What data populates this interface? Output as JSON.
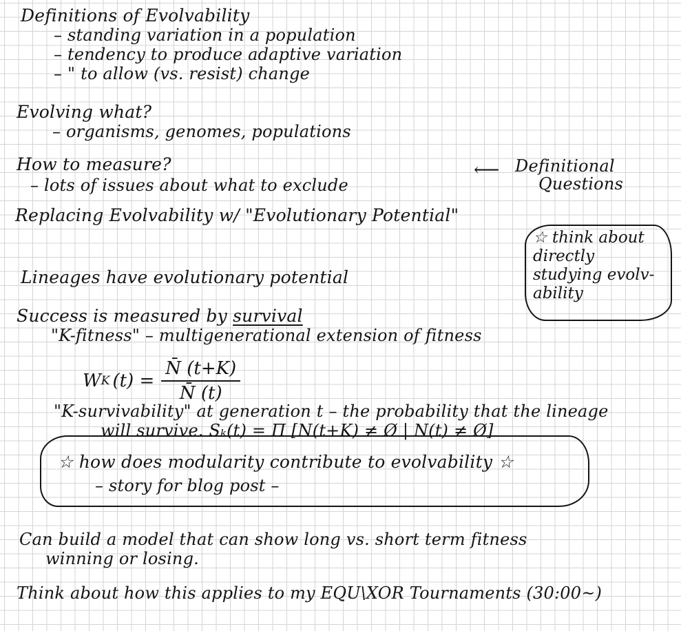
{
  "notes": {
    "l01": "Definitions of Evolvability",
    "l02": "– standing variation in a population",
    "l03": "– tendency to produce adaptive variation",
    "l04": "–     \"     to allow (vs. resist) change",
    "l05": "Evolving what?",
    "l06": "– organisms, genomes, populations",
    "l07": "How to measure?",
    "l08": "– lots of issues about what to exclude",
    "l09": "Definitional",
    "l10": "Questions",
    "l11": "Replacing Evolvability w/ \"Evolutionary Potential\"",
    "l12": "Lineages have evolutionary potential",
    "l13a": "Success is measured by ",
    "l13b": "survival",
    "l14": "\"K-fitness\" – multigenerational extension of fitness",
    "f_lhs": "W",
    "f_sub": "K",
    "f_arg": "(t) =",
    "f_num": "N̄ (t+K)",
    "f_den": "N̄ (t)",
    "l15": "\"K-survivability\" at generation t – the probability that the lineage",
    "l16": "will survive.  Sₖ(t) = Π [N(t+K) ≠ Ø | N(t) ≠ Ø]",
    "l17": "☆ how does modularity contribute to evolvability ☆",
    "l18": "– story for blog post –",
    "l19": "Can build a model that can show long vs. short term fitness",
    "l20": "winning or losing.",
    "l21": "Think about how this applies to my EQU\\XOR Tournaments (30:00~)",
    "bubble": "☆ think about\ndirectly\nstudying evolv-\nability"
  },
  "icons": {
    "left_arrow": "left-arrow-icon"
  }
}
